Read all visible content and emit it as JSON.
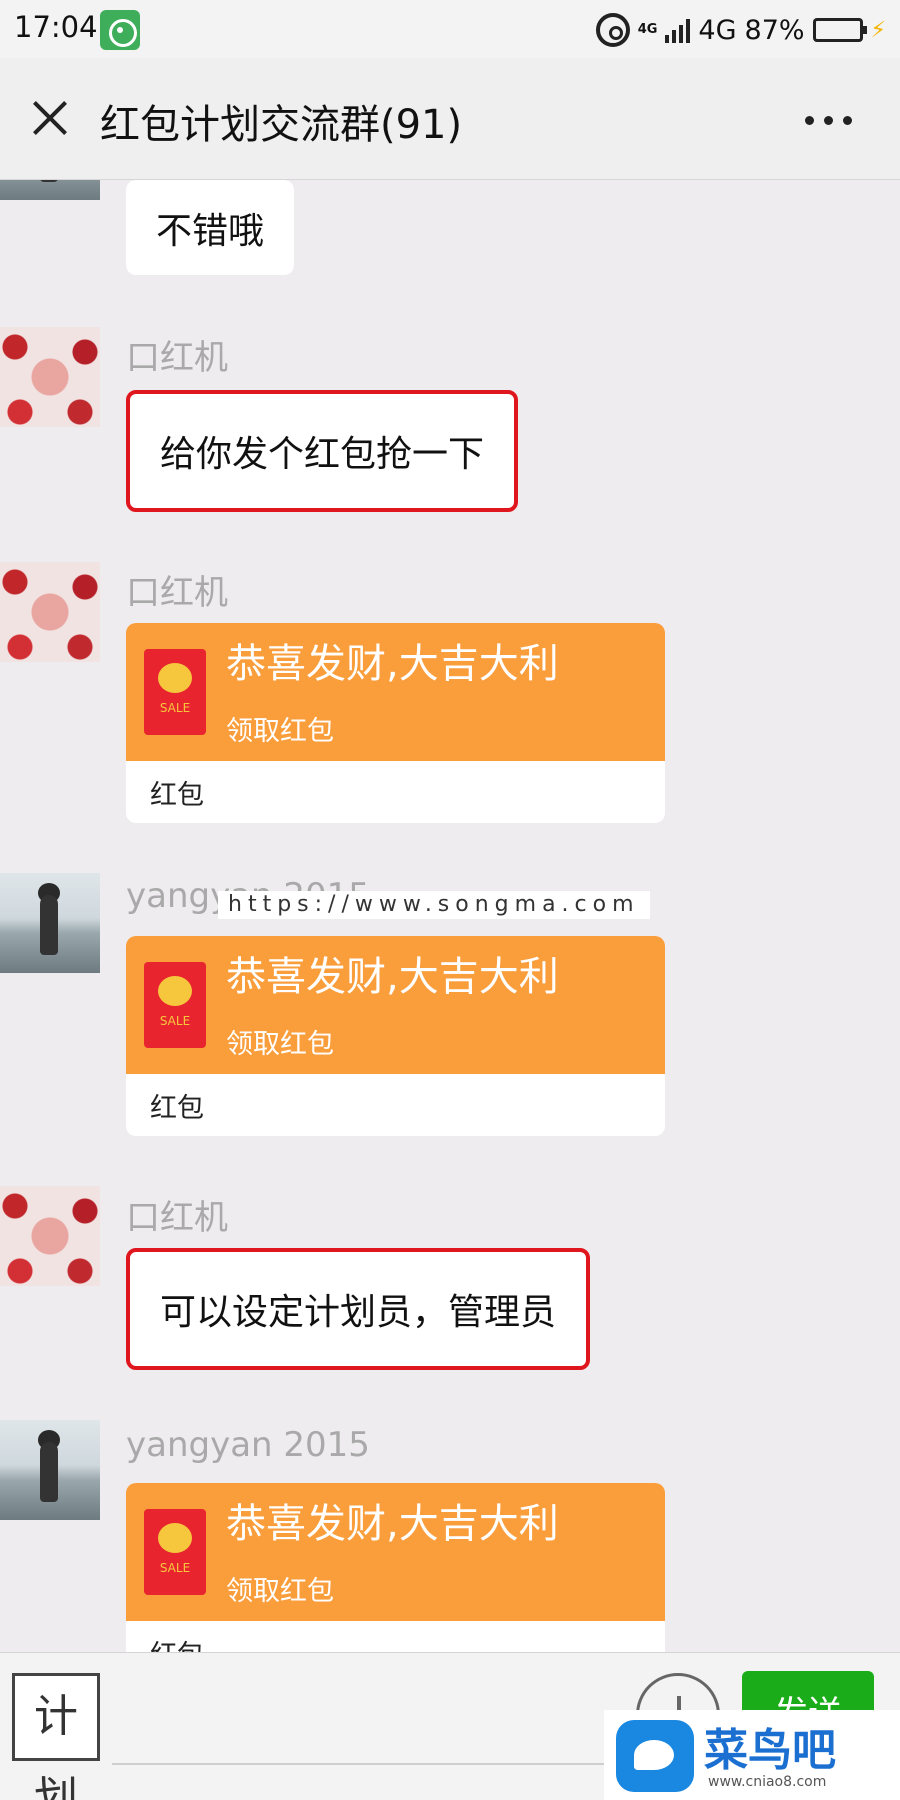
{
  "status_bar": {
    "time": "17:04",
    "network_small": "4G",
    "network": "4G",
    "battery": "87%",
    "battery_level": 0.87
  },
  "header": {
    "title": "红包计划交流群(91)"
  },
  "messages": [
    {
      "type": "text",
      "text": "不错哦"
    },
    {
      "type": "text",
      "sender": "口红机",
      "text": "给你发个红包抢一下",
      "highlighted": true
    },
    {
      "type": "red_packet",
      "sender": "口红机",
      "title": "恭喜发财,大吉大利",
      "subtitle": "领取红包",
      "footer": "红包"
    },
    {
      "type": "red_packet",
      "sender": "yangyan 2015",
      "title": "恭喜发财,大吉大利",
      "subtitle": "领取红包",
      "footer": "红包"
    },
    {
      "type": "text",
      "sender": "口红机",
      "text": "可以设定计划员，管理员",
      "highlighted": true
    },
    {
      "type": "red_packet",
      "sender": "yangyan 2015",
      "title": "恭喜发财,大吉大利",
      "subtitle": "领取红包",
      "footer": "红包"
    }
  ],
  "envelope_label": "SALE",
  "watermark": "https://www.songma.com",
  "input_bar": {
    "plan_label": "计划",
    "send_label": "发送"
  },
  "site_logo": {
    "text": "菜鸟吧",
    "url": "www.cniao8.com"
  },
  "colors": {
    "red_packet": "#fa9d3b",
    "highlight_border": "#e0161e",
    "send_button": "#1aad19",
    "chat_background": "#efecef"
  }
}
